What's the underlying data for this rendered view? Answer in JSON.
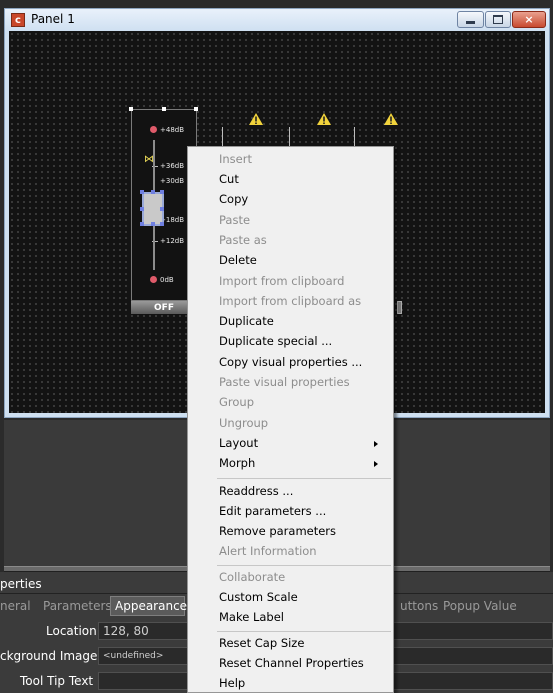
{
  "window": {
    "title": "Panel 1",
    "icon_letter": "c",
    "minimize": "minimize-icon",
    "maximize": "maximize-icon",
    "close_symbol": "×"
  },
  "fader": {
    "scale_labels": [
      "+48dB",
      "+36dB",
      "+30dB",
      "+18dB",
      "+12dB",
      "0dB"
    ],
    "off_label": "OFF"
  },
  "context_menu": {
    "items": [
      {
        "label": "Insert",
        "enabled": false
      },
      {
        "label": "Cut",
        "enabled": true
      },
      {
        "label": "Copy",
        "enabled": true
      },
      {
        "label": "Paste",
        "enabled": false
      },
      {
        "label": "Paste as",
        "enabled": false
      },
      {
        "label": "Delete",
        "enabled": true
      },
      {
        "label": "Import from clipboard",
        "enabled": false
      },
      {
        "label": "Import from clipboard as",
        "enabled": false
      },
      {
        "label": "Duplicate",
        "enabled": true
      },
      {
        "label": "Duplicate special ...",
        "enabled": true
      },
      {
        "label": "Copy visual properties ...",
        "enabled": true
      },
      {
        "label": "Paste visual properties",
        "enabled": false
      },
      {
        "label": "Group",
        "enabled": false
      },
      {
        "label": "Ungroup",
        "enabled": false
      },
      {
        "label": "Layout",
        "enabled": true,
        "submenu": true
      },
      {
        "label": "Morph",
        "enabled": true,
        "submenu": true
      },
      {
        "label": "Readdress ...",
        "enabled": true
      },
      {
        "label": "Edit parameters ...",
        "enabled": true
      },
      {
        "label": "Remove parameters",
        "enabled": true
      },
      {
        "label": "Alert Information",
        "enabled": false
      },
      {
        "label": "Collaborate",
        "enabled": false
      },
      {
        "label": "Custom Scale",
        "enabled": true
      },
      {
        "label": "Make Label",
        "enabled": true
      },
      {
        "label": "Reset Cap Size",
        "enabled": true
      },
      {
        "label": "Reset Channel Properties",
        "enabled": true
      },
      {
        "label": "Help",
        "enabled": true
      }
    ]
  },
  "properties": {
    "title": "perties",
    "tabs": [
      "neral",
      "Parameters",
      "Appearance",
      "uttons",
      "Popup Value"
    ],
    "active_tab": "Appearance",
    "rows": [
      {
        "label": "Location",
        "value": "128, 80"
      },
      {
        "label": "ckground Image",
        "value": "<undefined>"
      },
      {
        "label": "Tool Tip Text",
        "value": ""
      }
    ]
  },
  "colors": {
    "canvas_bg": "#131313",
    "window_frame": "#cfe0f1",
    "warning_yellow": "#f1d33c",
    "peak_marker": "#e05b6a",
    "menu_bg": "#f0f0f0",
    "disabled_text": "#8d8d8d"
  }
}
